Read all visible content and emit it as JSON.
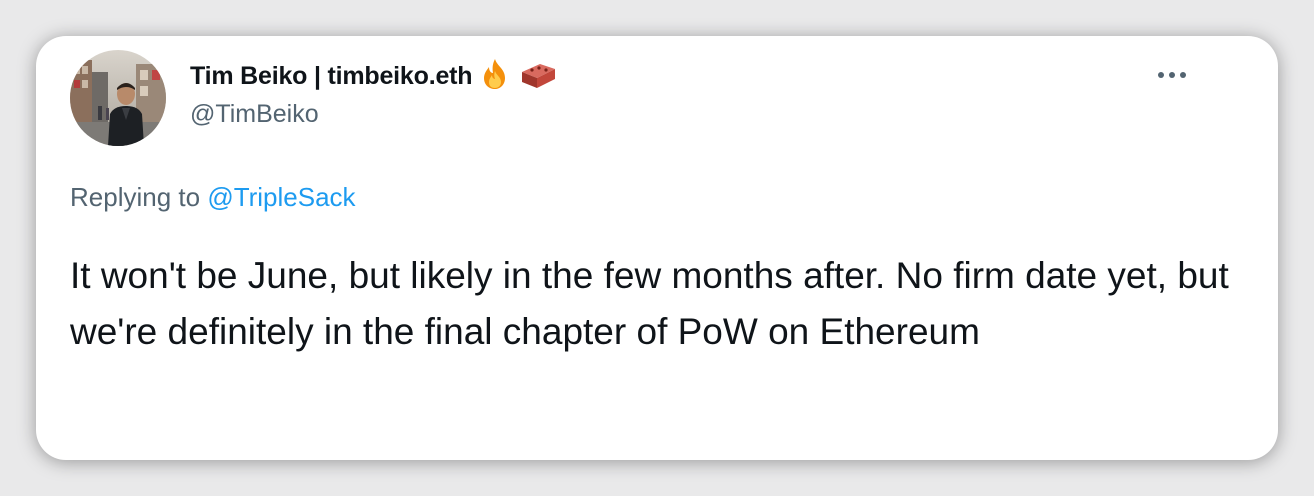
{
  "tweet": {
    "display_name": "Tim Beiko | timbeiko.eth",
    "name_emojis": [
      "fire-icon",
      "brick-icon"
    ],
    "handle": "@TimBeiko",
    "replying_prefix": "Replying to",
    "replying_to": "@TripleSack",
    "text": "It won't be June, but likely in the few months after. No firm date yet, but we're definitely in the final chapter of PoW on Ethereum"
  },
  "colors": {
    "primary_text": "#0f1419",
    "secondary_text": "#536471",
    "link": "#1d9bf0",
    "card_background": "#ffffff",
    "page_background": "#e9e9ea"
  },
  "icons": {
    "more": "more-options-icon"
  }
}
